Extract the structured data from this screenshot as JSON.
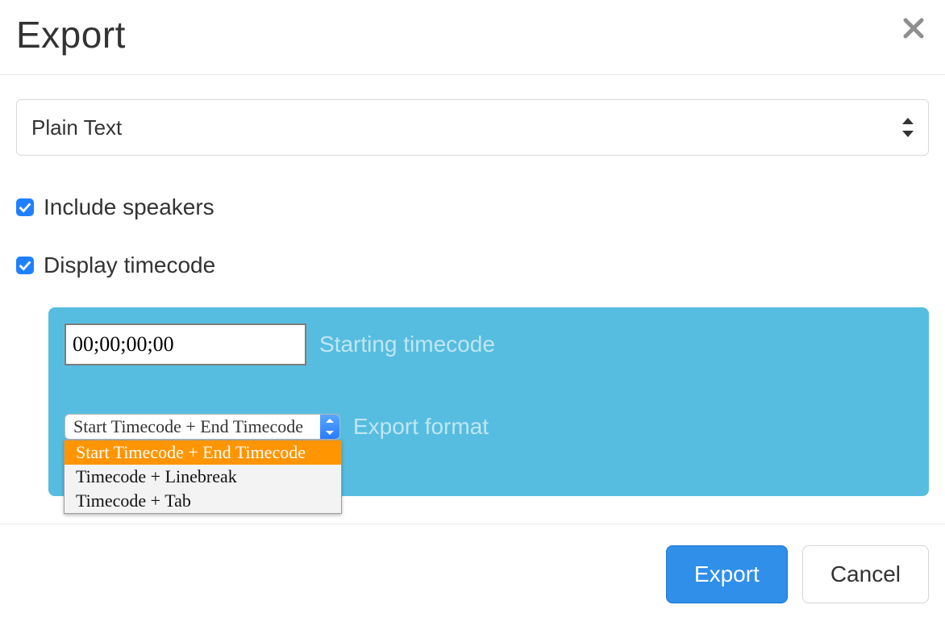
{
  "dialog": {
    "title": "Export"
  },
  "format": {
    "selected": "Plain Text"
  },
  "options": {
    "include_speakers_label": "Include speakers",
    "include_speakers_checked": true,
    "display_timecode_label": "Display timecode",
    "display_timecode_checked": true
  },
  "timecode": {
    "starting_value": "00;00;00;00",
    "starting_label": "Starting timecode",
    "export_format_label": "Export format",
    "export_format_selected": "Start Timecode + End Timecode",
    "export_format_options": [
      "Start Timecode + End Timecode",
      "Timecode + Linebreak",
      "Timecode + Tab"
    ]
  },
  "footer": {
    "export_label": "Export",
    "cancel_label": "Cancel"
  }
}
